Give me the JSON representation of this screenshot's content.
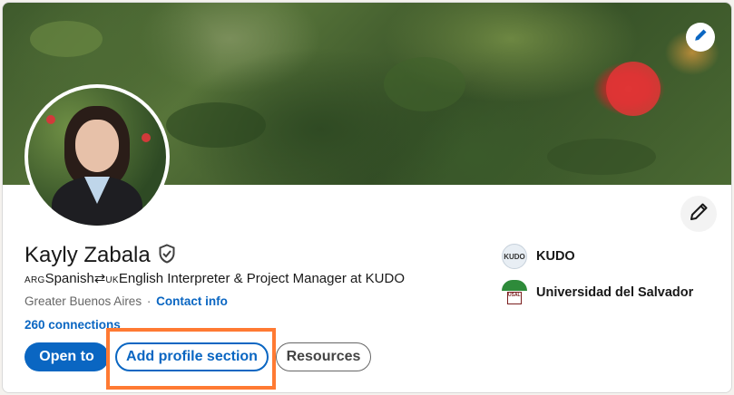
{
  "profile": {
    "name": "Kayly Zabala",
    "headline_prefix_from": "ARG",
    "headline_lang_from": "Spanish",
    "headline_arrow": "⇄",
    "headline_prefix_to": "UK",
    "headline_rest": "English Interpreter & Project Manager at KUDO",
    "location": "Greater Buenos Aires",
    "separator": "·",
    "contact_info": "Contact info",
    "connections": "260 connections"
  },
  "actions": {
    "open_to": "Open to",
    "add_profile_section": "Add profile section",
    "resources": "Resources"
  },
  "organizations": [
    {
      "name": "KUDO",
      "logo_text": "KUDO",
      "icon": "kudo-logo"
    },
    {
      "name": "Universidad del Salvador",
      "logo_text": "USAL",
      "icon": "usal-logo"
    }
  ],
  "colors": {
    "accent": "#0a66c2",
    "highlight": "#ff7a33"
  },
  "icons": {
    "banner_edit": "pencil-icon",
    "profile_edit": "pencil-icon",
    "verified": "shield-check-icon"
  }
}
